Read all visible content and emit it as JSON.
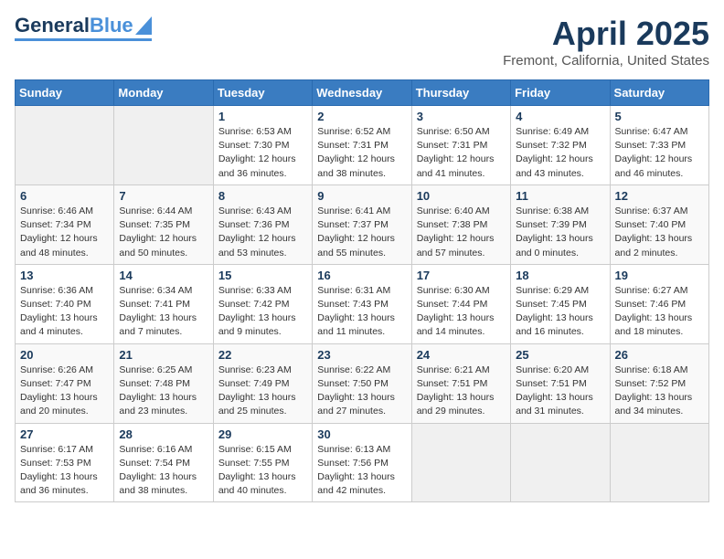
{
  "header": {
    "logo_general": "General",
    "logo_blue": "Blue",
    "title": "April 2025",
    "subtitle": "Fremont, California, United States"
  },
  "calendar": {
    "days_of_week": [
      "Sunday",
      "Monday",
      "Tuesday",
      "Wednesday",
      "Thursday",
      "Friday",
      "Saturday"
    ],
    "weeks": [
      [
        {
          "day": "",
          "info": ""
        },
        {
          "day": "",
          "info": ""
        },
        {
          "day": "1",
          "info": "Sunrise: 6:53 AM\nSunset: 7:30 PM\nDaylight: 12 hours and 36 minutes."
        },
        {
          "day": "2",
          "info": "Sunrise: 6:52 AM\nSunset: 7:31 PM\nDaylight: 12 hours and 38 minutes."
        },
        {
          "day": "3",
          "info": "Sunrise: 6:50 AM\nSunset: 7:31 PM\nDaylight: 12 hours and 41 minutes."
        },
        {
          "day": "4",
          "info": "Sunrise: 6:49 AM\nSunset: 7:32 PM\nDaylight: 12 hours and 43 minutes."
        },
        {
          "day": "5",
          "info": "Sunrise: 6:47 AM\nSunset: 7:33 PM\nDaylight: 12 hours and 46 minutes."
        }
      ],
      [
        {
          "day": "6",
          "info": "Sunrise: 6:46 AM\nSunset: 7:34 PM\nDaylight: 12 hours and 48 minutes."
        },
        {
          "day": "7",
          "info": "Sunrise: 6:44 AM\nSunset: 7:35 PM\nDaylight: 12 hours and 50 minutes."
        },
        {
          "day": "8",
          "info": "Sunrise: 6:43 AM\nSunset: 7:36 PM\nDaylight: 12 hours and 53 minutes."
        },
        {
          "day": "9",
          "info": "Sunrise: 6:41 AM\nSunset: 7:37 PM\nDaylight: 12 hours and 55 minutes."
        },
        {
          "day": "10",
          "info": "Sunrise: 6:40 AM\nSunset: 7:38 PM\nDaylight: 12 hours and 57 minutes."
        },
        {
          "day": "11",
          "info": "Sunrise: 6:38 AM\nSunset: 7:39 PM\nDaylight: 13 hours and 0 minutes."
        },
        {
          "day": "12",
          "info": "Sunrise: 6:37 AM\nSunset: 7:40 PM\nDaylight: 13 hours and 2 minutes."
        }
      ],
      [
        {
          "day": "13",
          "info": "Sunrise: 6:36 AM\nSunset: 7:40 PM\nDaylight: 13 hours and 4 minutes."
        },
        {
          "day": "14",
          "info": "Sunrise: 6:34 AM\nSunset: 7:41 PM\nDaylight: 13 hours and 7 minutes."
        },
        {
          "day": "15",
          "info": "Sunrise: 6:33 AM\nSunset: 7:42 PM\nDaylight: 13 hours and 9 minutes."
        },
        {
          "day": "16",
          "info": "Sunrise: 6:31 AM\nSunset: 7:43 PM\nDaylight: 13 hours and 11 minutes."
        },
        {
          "day": "17",
          "info": "Sunrise: 6:30 AM\nSunset: 7:44 PM\nDaylight: 13 hours and 14 minutes."
        },
        {
          "day": "18",
          "info": "Sunrise: 6:29 AM\nSunset: 7:45 PM\nDaylight: 13 hours and 16 minutes."
        },
        {
          "day": "19",
          "info": "Sunrise: 6:27 AM\nSunset: 7:46 PM\nDaylight: 13 hours and 18 minutes."
        }
      ],
      [
        {
          "day": "20",
          "info": "Sunrise: 6:26 AM\nSunset: 7:47 PM\nDaylight: 13 hours and 20 minutes."
        },
        {
          "day": "21",
          "info": "Sunrise: 6:25 AM\nSunset: 7:48 PM\nDaylight: 13 hours and 23 minutes."
        },
        {
          "day": "22",
          "info": "Sunrise: 6:23 AM\nSunset: 7:49 PM\nDaylight: 13 hours and 25 minutes."
        },
        {
          "day": "23",
          "info": "Sunrise: 6:22 AM\nSunset: 7:50 PM\nDaylight: 13 hours and 27 minutes."
        },
        {
          "day": "24",
          "info": "Sunrise: 6:21 AM\nSunset: 7:51 PM\nDaylight: 13 hours and 29 minutes."
        },
        {
          "day": "25",
          "info": "Sunrise: 6:20 AM\nSunset: 7:51 PM\nDaylight: 13 hours and 31 minutes."
        },
        {
          "day": "26",
          "info": "Sunrise: 6:18 AM\nSunset: 7:52 PM\nDaylight: 13 hours and 34 minutes."
        }
      ],
      [
        {
          "day": "27",
          "info": "Sunrise: 6:17 AM\nSunset: 7:53 PM\nDaylight: 13 hours and 36 minutes."
        },
        {
          "day": "28",
          "info": "Sunrise: 6:16 AM\nSunset: 7:54 PM\nDaylight: 13 hours and 38 minutes."
        },
        {
          "day": "29",
          "info": "Sunrise: 6:15 AM\nSunset: 7:55 PM\nDaylight: 13 hours and 40 minutes."
        },
        {
          "day": "30",
          "info": "Sunrise: 6:13 AM\nSunset: 7:56 PM\nDaylight: 13 hours and 42 minutes."
        },
        {
          "day": "",
          "info": ""
        },
        {
          "day": "",
          "info": ""
        },
        {
          "day": "",
          "info": ""
        }
      ]
    ]
  }
}
